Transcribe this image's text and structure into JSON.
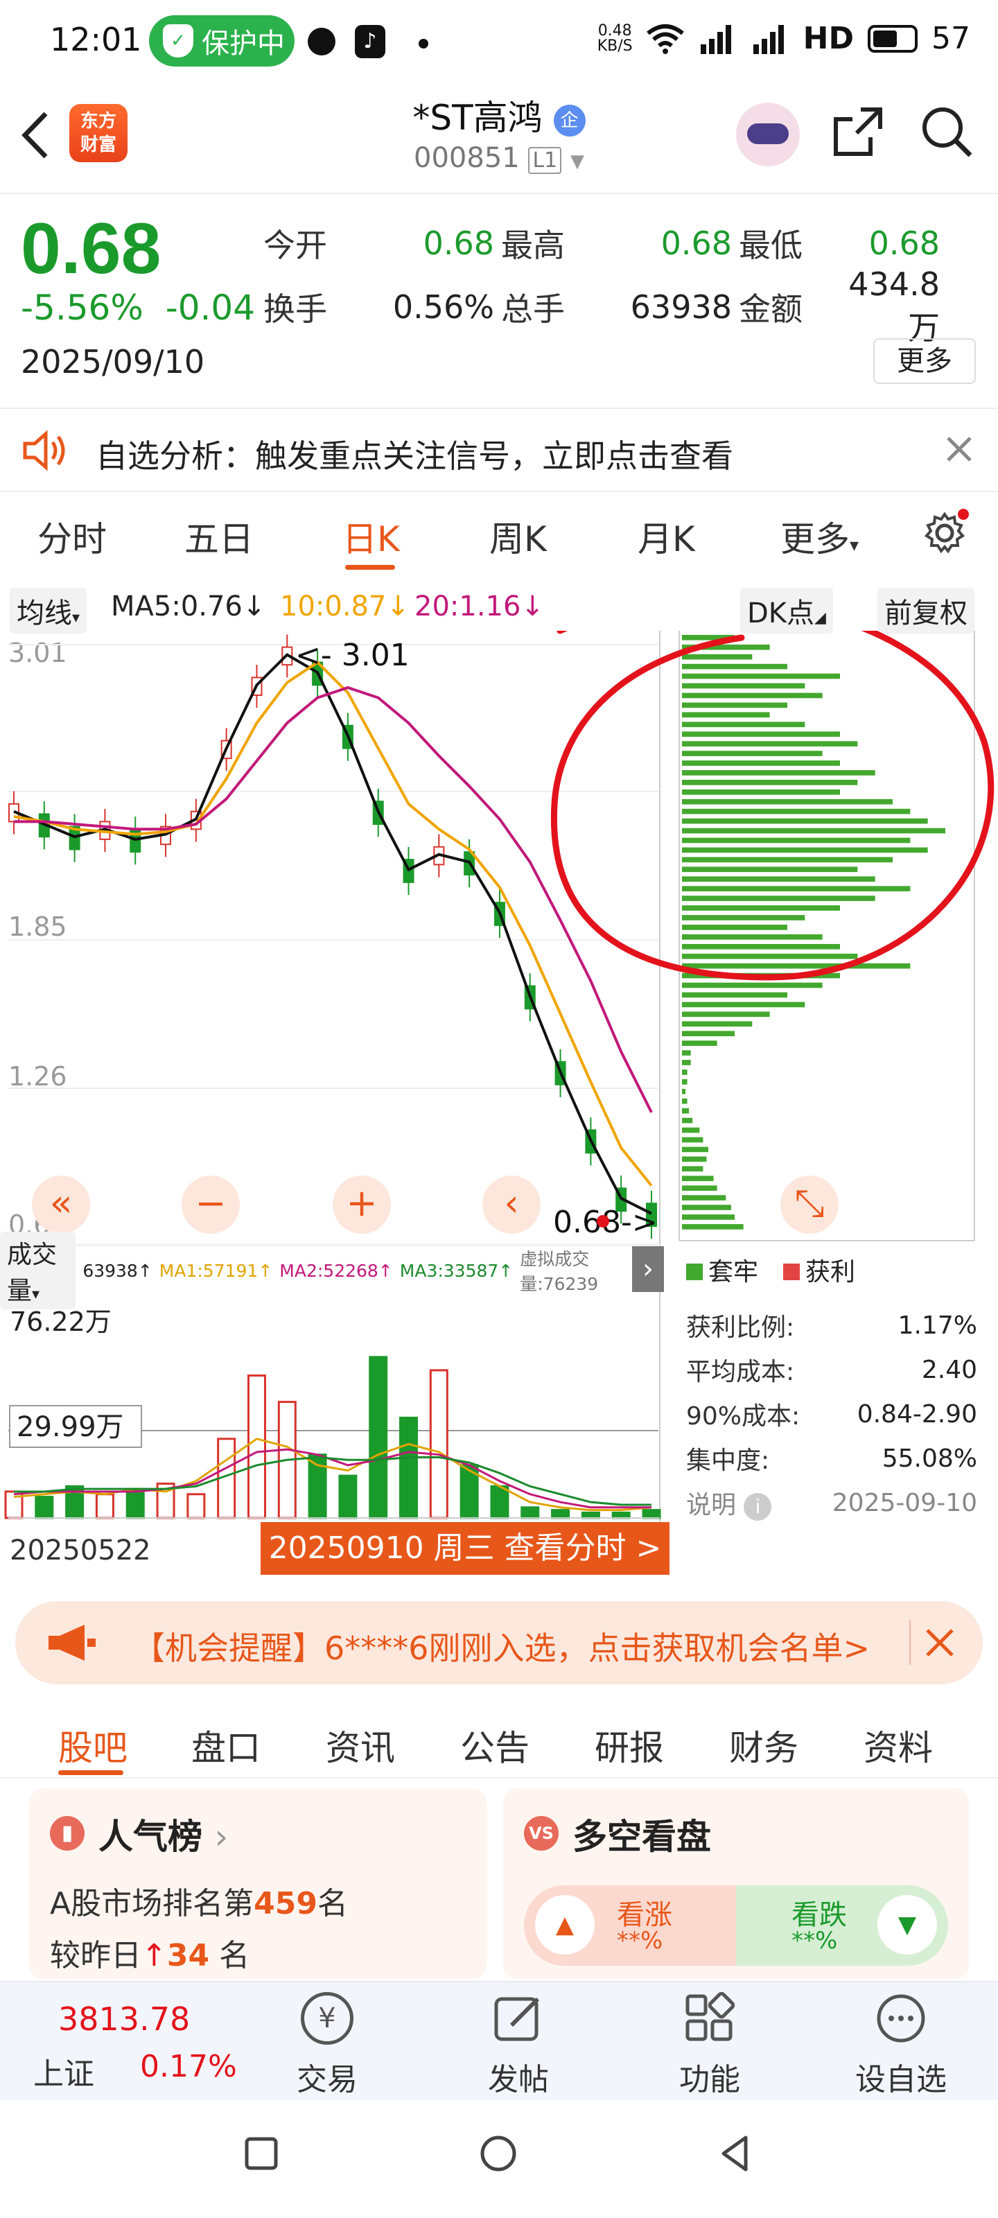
{
  "status_bar": {
    "time": "12:01",
    "protect_label": "保护中",
    "net_speed": "0.48\nKB/S",
    "hd": "HD",
    "battery": "57"
  },
  "header": {
    "logo_text": "东方\n财富",
    "title": "*ST高鸿",
    "badge": "企",
    "code": "000851",
    "level": "L1"
  },
  "quote": {
    "price": "0.68",
    "change_pct": "-5.56%",
    "change": "-0.04",
    "date": "2025/09/10",
    "fields": [
      {
        "label": "今开",
        "value": "0.68",
        "color": "green"
      },
      {
        "label": "最高",
        "value": "0.68",
        "color": "green"
      },
      {
        "label": "最低",
        "value": "0.68",
        "color": "green"
      },
      {
        "label": "换手",
        "value": "0.56%",
        "color": "dark"
      },
      {
        "label": "总手",
        "value": "63938",
        "color": "dark"
      },
      {
        "label": "金额",
        "value": "434.8万",
        "color": "dark"
      }
    ],
    "more_label": "更多"
  },
  "alert": {
    "text": "自选分析：触发重点关注信号，立即点击查看"
  },
  "tabs": [
    "分时",
    "五日",
    "日K",
    "周K",
    "月K",
    "更多"
  ],
  "active_tab": "日K",
  "ma_row": {
    "indicator": "均线",
    "ma5": "MA5:0.76↓",
    "ma10": "10:0.87↓",
    "ma20": "20:1.16↓",
    "dk": "DK点",
    "adjust": "前复权"
  },
  "colors": {
    "accent": "#e8571a",
    "down": "#1b9a2c",
    "up": "#d9332b",
    "ma5": "#111111",
    "ma10": "#f0a500",
    "ma20": "#c2187a",
    "annotation": "#e3121b"
  },
  "chart_data": [
    {
      "type": "candlestick",
      "title": "日K",
      "y_ticks": [
        "3.01",
        "1.85",
        "1.26",
        "0.68"
      ],
      "labels": [
        "3.01",
        "0.68"
      ],
      "x_start": "20250522",
      "x_end": "20250910",
      "series": [
        {
          "name": "MA5",
          "values": [
            2.35,
            2.3,
            2.25,
            2.28,
            2.24,
            2.26,
            2.32,
            2.6,
            2.85,
            2.97,
            2.9,
            2.65,
            2.35,
            2.12,
            2.18,
            2.15,
            1.95,
            1.62,
            1.32,
            1.05,
            0.82,
            0.76
          ]
        },
        {
          "name": "MA10",
          "values": [
            2.33,
            2.31,
            2.28,
            2.27,
            2.26,
            2.27,
            2.3,
            2.48,
            2.7,
            2.86,
            2.94,
            2.82,
            2.6,
            2.38,
            2.28,
            2.2,
            2.05,
            1.82,
            1.55,
            1.28,
            1.02,
            0.87
          ]
        },
        {
          "name": "MA20",
          "values": [
            2.31,
            2.31,
            2.3,
            2.29,
            2.28,
            2.28,
            2.3,
            2.4,
            2.55,
            2.7,
            2.8,
            2.84,
            2.8,
            2.7,
            2.57,
            2.45,
            2.32,
            2.15,
            1.92,
            1.68,
            1.4,
            1.16
          ]
        }
      ]
    },
    {
      "type": "bar",
      "title": "成交量",
      "y_ticks": [
        "76.22万",
        "29.99万"
      ],
      "series": [
        {
          "name": "MA1",
          "values": [
            8,
            9,
            10,
            9,
            11,
            10,
            14,
            22,
            30,
            27,
            20,
            18,
            24,
            28,
            25,
            18,
            12,
            6,
            4,
            3,
            3,
            4
          ]
        },
        {
          "name": "MA2",
          "values": [
            9,
            10,
            10,
            10,
            10,
            11,
            13,
            19,
            25,
            26,
            24,
            20,
            22,
            25,
            24,
            20,
            14,
            9,
            6,
            4,
            4,
            4
          ]
        },
        {
          "name": "MA3",
          "values": [
            10,
            10,
            11,
            11,
            11,
            11,
            12,
            16,
            20,
            22,
            23,
            22,
            22,
            23,
            23,
            21,
            17,
            12,
            9,
            6,
            5,
            5
          ]
        }
      ],
      "values": [
        10,
        8,
        12,
        9,
        11,
        13,
        9,
        30,
        54,
        44,
        24,
        16,
        61,
        38,
        56,
        20,
        12,
        4,
        3,
        2,
        2,
        3
      ]
    },
    {
      "type": "bar",
      "title": "DK点",
      "legend": [
        "套牢",
        "获利"
      ],
      "values": [
        0.3,
        0.5,
        0.4,
        0.6,
        0.9,
        0.7,
        0.8,
        0.6,
        0.5,
        0.7,
        0.9,
        1.0,
        0.8,
        0.9,
        1.1,
        1.0,
        0.9,
        1.2,
        1.3,
        1.4,
        1.5,
        1.3,
        1.4,
        1.2,
        1.0,
        1.1,
        1.3,
        1.1,
        0.9,
        0.7,
        0.6,
        0.8,
        0.9,
        1.0,
        1.3,
        0.9,
        0.8,
        0.6,
        0.7,
        0.5,
        0.4,
        0.3,
        0.2,
        0.05,
        0.05,
        0.03,
        0.03,
        0.02,
        0.03,
        0.04,
        0.06,
        0.1,
        0.12,
        0.15,
        0.14,
        0.12,
        0.18,
        0.2,
        0.25,
        0.28,
        0.3,
        0.35
      ]
    }
  ],
  "volume_row": {
    "label": "成交量",
    "total": "63938↑",
    "ma1": "MA1:57191↑",
    "ma2": "MA2:52268↑",
    "ma3": "MA3:33587↑",
    "virtual": "虚拟成交量:76239"
  },
  "chart_texts": {
    "hi_label": "3.01",
    "lo_label": "0.68->",
    "vol_max": "76.22万",
    "vol_mid": "29.99万",
    "start_date": "20250522",
    "date_badge": "20250910 周三 查看分时 >"
  },
  "dk_panel": {
    "legend_trapped": "套牢",
    "legend_profit": "获利",
    "rows": [
      {
        "label": "获利比例:",
        "value": "1.17%"
      },
      {
        "label": "平均成本:",
        "value": "2.40"
      },
      {
        "label": "90%成本:",
        "value": "0.84-2.90"
      },
      {
        "label": "集中度:",
        "value": "55.08%"
      }
    ],
    "note_label": "说明",
    "note_date": "2025-09-10"
  },
  "opportunity": {
    "text": "【机会提醒】6****6刚刚入选，点击获取机会名单>"
  },
  "bottom_tabs": [
    "股吧",
    "盘口",
    "资讯",
    "公告",
    "研报",
    "财务",
    "资料"
  ],
  "popularity": {
    "title": "人气榜",
    "line1_pre": "A股市场排名第",
    "rank": "459",
    "line1_post": "名",
    "line2_pre": "较昨日",
    "delta": "34",
    "line2_post": "名"
  },
  "sentiment": {
    "title": "多空看盘",
    "bull_label": "看涨",
    "bull_value": "**%",
    "bear_label": "看跌",
    "bear_value": "**%"
  },
  "bottom_nav": {
    "index_value": "3813.78",
    "index_name": "上证",
    "index_change": "0.17%",
    "items": [
      "交易",
      "发帖",
      "功能",
      "设自选"
    ]
  }
}
